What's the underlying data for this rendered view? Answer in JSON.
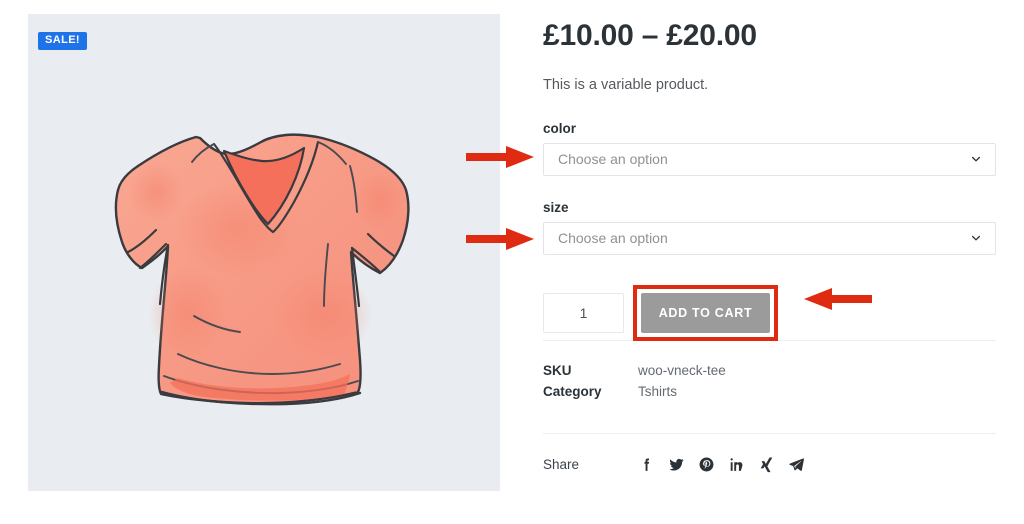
{
  "gallery": {
    "sale_badge": "SALE!",
    "badge_color": "#1e73e8",
    "background_color": "#e9edf1",
    "product_image_alt": "pink v-neck t-shirt illustration"
  },
  "summary": {
    "price": "£10.00 – £20.00",
    "short_description": "This is a variable product.",
    "attributes": [
      {
        "label": "color",
        "selected": "Choose an option",
        "icon": "chevron-down-icon"
      },
      {
        "label": "size",
        "selected": "Choose an option",
        "icon": "chevron-down-icon"
      }
    ],
    "quantity": "1",
    "add_to_cart_label": "ADD TO CART",
    "meta": [
      {
        "key": "SKU",
        "value": "woo-vneck-tee"
      },
      {
        "key": "Category",
        "value": "Tshirts"
      }
    ],
    "share": {
      "label": "Share",
      "icons": [
        "facebook-icon",
        "twitter-icon",
        "pinterest-icon",
        "linkedin-icon",
        "xing-icon",
        "telegram-icon"
      ]
    }
  },
  "annotations": {
    "color": "#e02b13",
    "arrows": [
      {
        "name": "arrow-to-color-select",
        "direction": "right"
      },
      {
        "name": "arrow-to-size-select",
        "direction": "right"
      },
      {
        "name": "arrow-to-add-to-cart",
        "direction": "left"
      }
    ],
    "highlight_box": "add-to-cart-highlight"
  }
}
